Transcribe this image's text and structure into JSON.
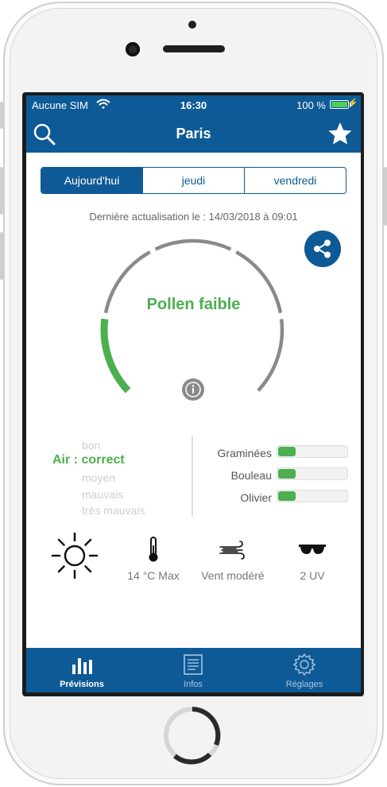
{
  "status_bar": {
    "carrier": "Aucune SIM",
    "time": "16:30",
    "battery": "100 %"
  },
  "nav": {
    "title": "Paris",
    "search_icon": "search-icon",
    "favorite_icon": "star-icon"
  },
  "tabs": [
    {
      "label": "Aujourd'hui",
      "selected": true
    },
    {
      "label": "jeudi",
      "selected": false
    },
    {
      "label": "vendredi",
      "selected": false
    }
  ],
  "last_update": "Dernière actualisation le : 14/03/2018 à 09:01",
  "gauge": {
    "label": "Pollen faible",
    "level": 0.2,
    "color": "#4caf50"
  },
  "air": {
    "prefix": "Air :",
    "value": "correct",
    "scale": [
      "bon",
      "correct",
      "moyen",
      "mauvais",
      "très mauvais"
    ],
    "selected_index": 1
  },
  "pollens": [
    {
      "name": "Graminées",
      "level": 0.25
    },
    {
      "name": "Bouleau",
      "level": 0.25
    },
    {
      "name": "Olivier",
      "level": 0.25
    }
  ],
  "weather": {
    "sun_icon": "sun-icon",
    "temperature": "14 °C Max",
    "wind": "Vent modéré",
    "uv": "2 UV"
  },
  "bottom_nav": [
    {
      "label": "Prévisions",
      "icon": "chart-icon",
      "active": true
    },
    {
      "label": "Infos",
      "icon": "document-icon",
      "active": false
    },
    {
      "label": "Réglages",
      "icon": "settings-icon",
      "active": false
    }
  ],
  "colors": {
    "primary": "#0e5a96",
    "good": "#4caf50",
    "gauge_track": "#8a8a8a"
  }
}
